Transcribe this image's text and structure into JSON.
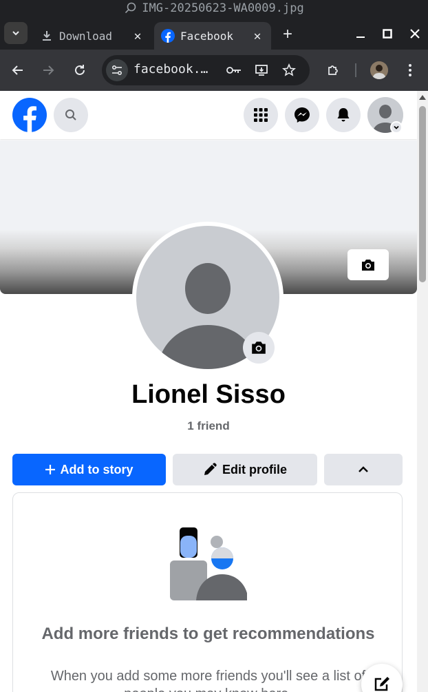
{
  "window": {
    "title": "IMG-20250623-WA0009.jpg"
  },
  "tabs": [
    {
      "label": "Download",
      "active": false
    },
    {
      "label": "Facebook",
      "active": true
    }
  ],
  "toolbar": {
    "url": "facebook.…"
  },
  "profile": {
    "name": "Lionel Sisso",
    "friends": "1 friend"
  },
  "actions": {
    "add_story": "Add to story",
    "edit_profile": "Edit profile"
  },
  "suggestions_card": {
    "title": "Add more friends to get recommendations",
    "subtitle": "When you add some more friends you'll see a list of people you may know here."
  },
  "colors": {
    "fb_blue": "#0866ff",
    "chrome_dark": "#202124",
    "chrome_toolbar": "#35363a",
    "button_gray": "#e4e6eb",
    "text_secondary": "#65676b"
  },
  "icons": {
    "search": "search-icon",
    "apps": "menu-grid-icon",
    "messenger": "messenger-icon",
    "notifications": "bell-icon",
    "camera": "camera-icon",
    "edit": "pencil-icon",
    "compose": "compose-icon"
  }
}
